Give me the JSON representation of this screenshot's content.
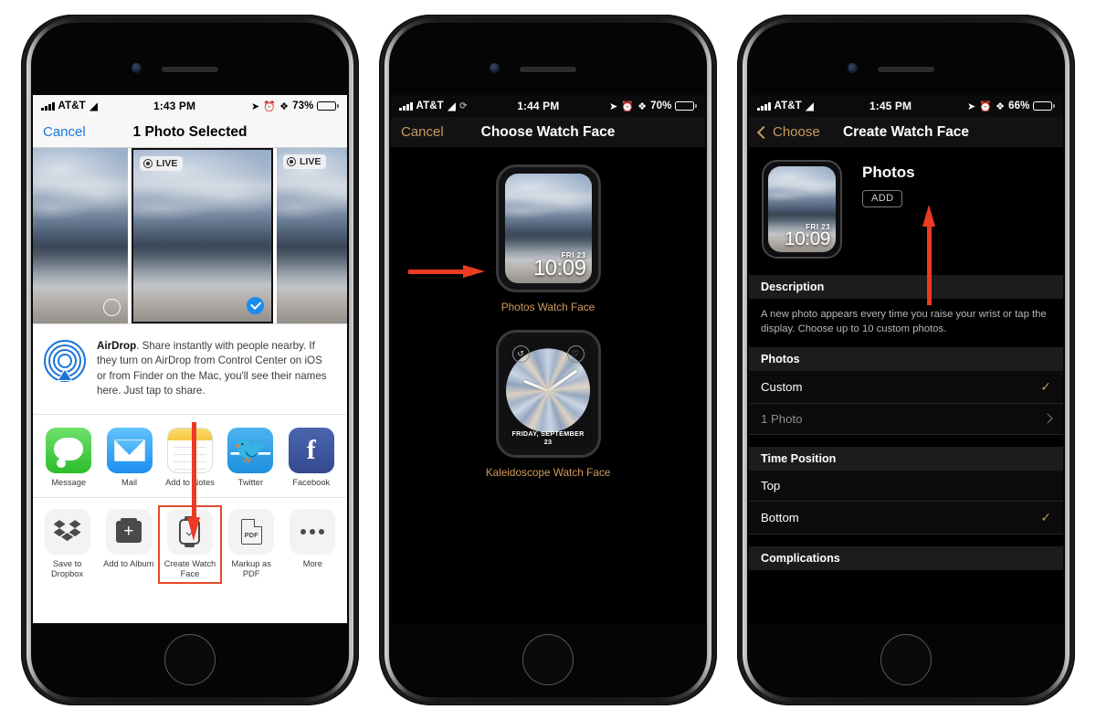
{
  "meta": {
    "accent_red": "#ec3a24",
    "ios_blue": "#1b74d8",
    "watch_gold": "#c99a5b"
  },
  "phone1": {
    "status": {
      "carrier": "AT&T",
      "time": "1:43 PM",
      "battery": "73%"
    },
    "nav": {
      "left": "Cancel",
      "title": "1 Photo Selected"
    },
    "photos": [
      {
        "live": "",
        "selected": false
      },
      {
        "live": "LIVE",
        "selected": true
      },
      {
        "live": "LIVE",
        "selected": false
      }
    ],
    "airdrop": {
      "title": "AirDrop",
      "body": ". Share instantly with people nearby. If they turn on AirDrop from Control Center on iOS or from Finder on the Mac, you'll see their names here. Just tap to share."
    },
    "apps": [
      {
        "label": "Message"
      },
      {
        "label": "Mail"
      },
      {
        "label": "Add to Notes"
      },
      {
        "label": "Twitter"
      },
      {
        "label": "Facebook"
      }
    ],
    "actions": [
      {
        "label": "Save to Dropbox",
        "highlight": false
      },
      {
        "label": "Add to Album",
        "highlight": false
      },
      {
        "label": "Create Watch Face",
        "highlight": true
      },
      {
        "label": "Markup as PDF",
        "highlight": false
      },
      {
        "label": "More",
        "highlight": false
      }
    ],
    "pdf_glyph_text": "PDF"
  },
  "phone2": {
    "status": {
      "carrier": "AT&T",
      "time": "1:44 PM",
      "battery": "70%"
    },
    "nav": {
      "left": "Cancel",
      "title": "Choose Watch Face"
    },
    "faces": [
      {
        "caption": "Photos Watch Face",
        "date": "FRI 23",
        "time": "10:09"
      },
      {
        "caption": "Kaleidoscope Watch Face",
        "date": "FRIDAY, SEPTEMBER 23"
      }
    ]
  },
  "phone3": {
    "status": {
      "carrier": "AT&T",
      "time": "1:45 PM",
      "battery": "66%"
    },
    "nav": {
      "left": "Choose",
      "title": "Create Watch Face"
    },
    "preview": {
      "title": "Photos",
      "add_label": "ADD",
      "date": "FRI 23",
      "time": "10:09"
    },
    "sections": [
      {
        "header": "Description",
        "body": "A new photo appears every time you raise your wrist or tap the display. Choose up to 10 custom photos."
      },
      {
        "header": "Photos",
        "rows": [
          {
            "label": "Custom",
            "check": "✓",
            "dim": false
          },
          {
            "label": "1 Photo",
            "chevron": true,
            "dim": true
          }
        ]
      },
      {
        "header": "Time Position",
        "rows": [
          {
            "label": "Top",
            "dim": false
          },
          {
            "label": "Bottom",
            "check": "✓",
            "dim": false
          }
        ]
      },
      {
        "header": "Complications"
      }
    ]
  }
}
